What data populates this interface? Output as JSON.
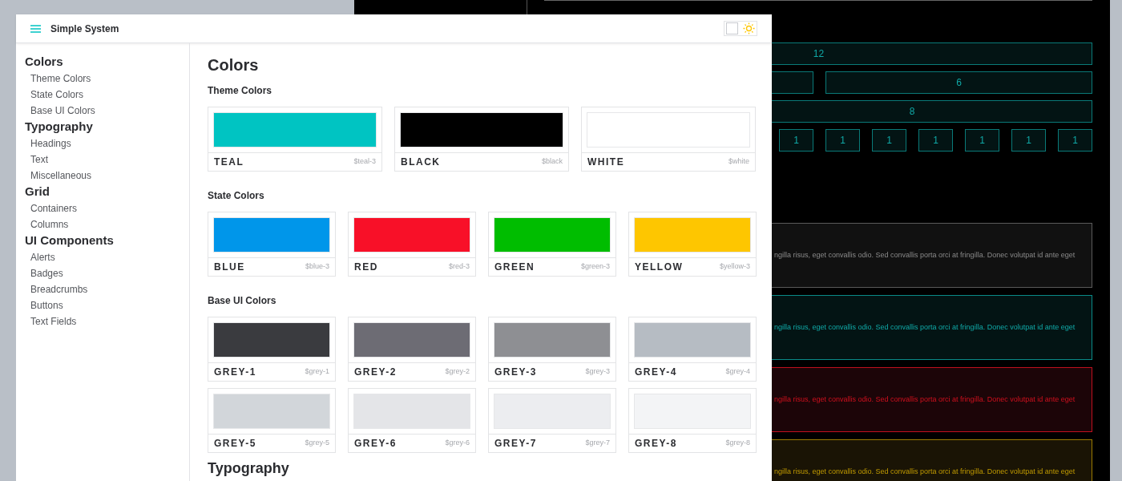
{
  "header": {
    "title": "Simple System",
    "theme_toggle": {
      "dark_mode": false
    }
  },
  "sidebar": {
    "groups": [
      {
        "heading": "Colors",
        "items": [
          "Theme Colors",
          "State Colors",
          "Base UI Colors"
        ]
      },
      {
        "heading": "Typography",
        "items": [
          "Headings",
          "Text",
          "Miscellaneous"
        ]
      },
      {
        "heading": "Grid",
        "items": [
          "Containers",
          "Columns"
        ]
      },
      {
        "heading": "UI Components",
        "items": [
          "Alerts",
          "Badges",
          "Breadcrumbs",
          "Buttons",
          "Text Fields"
        ]
      }
    ]
  },
  "main": {
    "title": "Colors",
    "sections": [
      {
        "title": "Theme Colors",
        "swatches": [
          {
            "name": "TEAL",
            "variable": "$teal-3",
            "color": "#00c4c2"
          },
          {
            "name": "BLACK",
            "variable": "$black",
            "color": "#000000"
          },
          {
            "name": "WHITE",
            "variable": "$white",
            "color": "#ffffff"
          }
        ]
      },
      {
        "title": "State Colors",
        "swatches": [
          {
            "name": "BLUE",
            "variable": "$blue-3",
            "color": "#0096ea"
          },
          {
            "name": "RED",
            "variable": "$red-3",
            "color": "#f81028"
          },
          {
            "name": "GREEN",
            "variable": "$green-3",
            "color": "#00bd00"
          },
          {
            "name": "YELLOW",
            "variable": "$yellow-3",
            "color": "#fec600"
          }
        ]
      },
      {
        "title": "Base UI Colors",
        "swatches": [
          {
            "name": "GREY-1",
            "variable": "$grey-1",
            "color": "#3a3b3f"
          },
          {
            "name": "GREY-2",
            "variable": "$grey-2",
            "color": "#6d6c74"
          },
          {
            "name": "GREY-3",
            "variable": "$grey-3",
            "color": "#8e8f93"
          },
          {
            "name": "GREY-4",
            "variable": "$grey-4",
            "color": "#b6bcc3"
          },
          {
            "name": "GREY-5",
            "variable": "$grey-5",
            "color": "#d2d6da"
          },
          {
            "name": "GREY-6",
            "variable": "$grey-6",
            "color": "#e4e5e8"
          },
          {
            "name": "GREY-7",
            "variable": "$grey-7",
            "color": "#ecedf0"
          },
          {
            "name": "GREY-8",
            "variable": "$grey-8",
            "color": "#f3f4f6"
          }
        ]
      }
    ],
    "next_heading": "Typography"
  },
  "dark_window": {
    "grid_rows": [
      [
        "12"
      ],
      [
        "6"
      ],
      [
        "8"
      ],
      [
        "1",
        "1",
        "1",
        "1",
        "1",
        "1",
        "1"
      ]
    ],
    "alerts": [
      {
        "kind": "neutral",
        "text": "ngilla risus, eget convallis odio. Sed convallis porta orci at fringilla. Donec volutpat id ante eget"
      },
      {
        "kind": "info",
        "text": "ngilla risus, eget convallis odio. Sed convallis porta orci at fringilla. Donec volutpat id ante eget"
      },
      {
        "kind": "error",
        "text": "ngilla risus, eget convallis odio. Sed convallis porta orci at fringilla. Donec volutpat id ante eget"
      },
      {
        "kind": "warning",
        "text": "ngilla risus, eget convallis odio. Sed convallis porta orci at fringilla. Donec volutpat id ante eget"
      }
    ]
  }
}
